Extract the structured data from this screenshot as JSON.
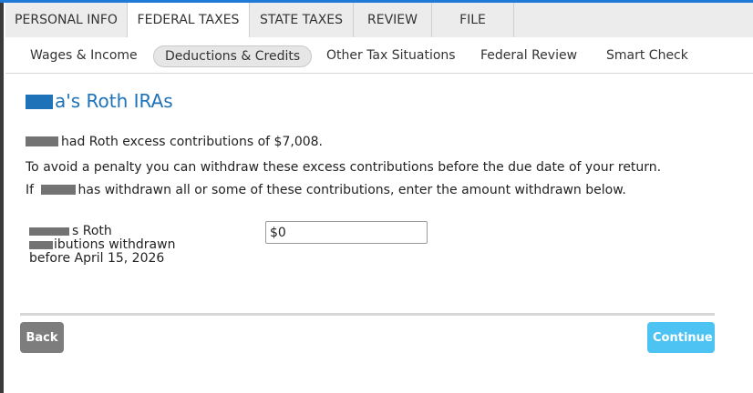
{
  "top_tabs": [
    {
      "label": "PERSONAL INFO"
    },
    {
      "label": "FEDERAL TAXES"
    },
    {
      "label": "STATE TAXES"
    },
    {
      "label": "REVIEW"
    },
    {
      "label": "FILE"
    }
  ],
  "sub_tabs": [
    {
      "label": "Wages & Income"
    },
    {
      "label": "Deductions & Credits"
    },
    {
      "label": "Other Tax Situations"
    },
    {
      "label": "Federal Review"
    },
    {
      "label": "Smart Check"
    }
  ],
  "main": {
    "title_suffix": "a's Roth IRAs",
    "line1": "had Roth excess contributions of $7,008.",
    "line2": "To avoid a penalty you can withdraw these excess contributions before the due date of your return.",
    "line3_prefix": "If",
    "line3_suffix": "has withdrawn all or some of these contributions, enter the amount withdrawn below.",
    "field_label_line1": "s Roth",
    "field_label_line2": "ibutions withdrawn",
    "field_label_line3": "before April 15, 2026",
    "amount_value": "$0"
  },
  "buttons": {
    "back": "Back",
    "continue": "Continue"
  },
  "colors": {
    "accent_blue": "#1d72b8",
    "continue_button": "#4cc3f2",
    "back_button": "#7d7d7d",
    "top_bar": "#1e7ad6"
  }
}
